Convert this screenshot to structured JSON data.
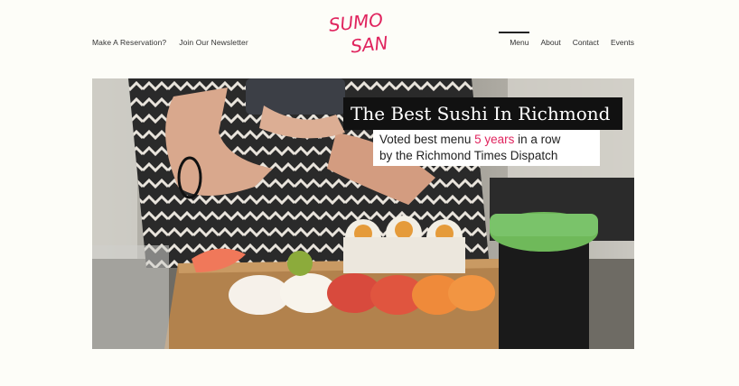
{
  "header": {
    "left_links": [
      "Make A Reservation?",
      "Join Our Newsletter"
    ],
    "logo_line1": "SUMO",
    "logo_line2": "SAN",
    "nav": [
      "Menu",
      "About",
      "Contact",
      "Events"
    ],
    "active_nav": "Menu"
  },
  "hero": {
    "headline": "The Best Sushi In Richmond",
    "tagline_prefix": "Voted best menu ",
    "tagline_highlight": "5 years",
    "tagline_suffix": " in a row",
    "tagline_line2": "by the Richmond Times Dispatch"
  },
  "colors": {
    "accent": "#e0245e",
    "background": "#fdfdf8",
    "headline_bg": "#111111"
  }
}
